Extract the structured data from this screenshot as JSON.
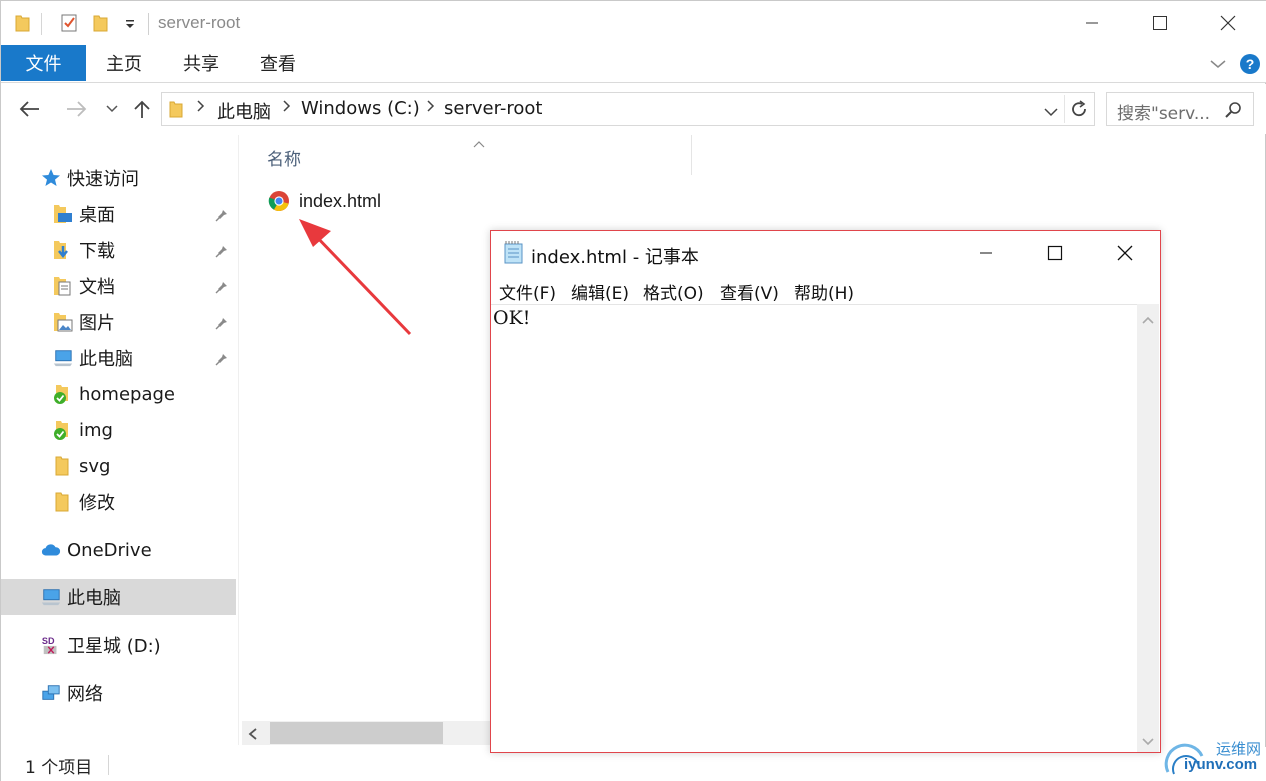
{
  "window": {
    "title": "server-root",
    "quick_access_toolbar": [
      "folder-icon",
      "properties-check-icon",
      "new-folder-icon",
      "customize-dropdown-icon"
    ]
  },
  "ribbon": {
    "tabs": [
      {
        "label": "文件"
      },
      {
        "label": "主页"
      },
      {
        "label": "共享"
      },
      {
        "label": "查看"
      }
    ]
  },
  "address": {
    "breadcrumbs": [
      "此电脑",
      "Windows (C:)",
      "server-root"
    ],
    "search_placeholder": "搜索\"serv..."
  },
  "navigation": {
    "quick_access_label": "快速访问",
    "quick_items": [
      {
        "label": "桌面",
        "icon": "desktop-folder-icon",
        "pinned": true
      },
      {
        "label": "下载",
        "icon": "downloads-folder-icon",
        "pinned": true
      },
      {
        "label": "文档",
        "icon": "documents-folder-icon",
        "pinned": true
      },
      {
        "label": "图片",
        "icon": "pictures-folder-icon",
        "pinned": true
      },
      {
        "label": "此电脑",
        "icon": "computer-icon",
        "pinned": true
      },
      {
        "label": "homepage",
        "icon": "synced-folder-icon",
        "pinned": false
      },
      {
        "label": "img",
        "icon": "synced-folder-icon",
        "pinned": false
      },
      {
        "label": "svg",
        "icon": "folder-icon",
        "pinned": false
      },
      {
        "label": "修改",
        "icon": "folder-icon",
        "pinned": false
      }
    ],
    "onedrive_label": "OneDrive",
    "thispc_label": "此电脑",
    "drive_label": "卫星城 (D:)",
    "network_label": "网络"
  },
  "content": {
    "column_header": "名称",
    "files": [
      {
        "name": "index.html",
        "icon": "chrome-icon"
      }
    ]
  },
  "status": {
    "item_count": "1 个项目"
  },
  "notepad": {
    "title": "index.html - 记事本",
    "menu": [
      "文件(F)",
      "编辑(E)",
      "格式(O)",
      "查看(V)",
      "帮助(H)"
    ],
    "content": "OK!"
  },
  "watermark": {
    "text_top": "运维网",
    "text_bottom": "iyunv.com"
  },
  "colors": {
    "file_tab_bg": "#1979ca",
    "help_icon": "#1979ca",
    "selection_bg": "#d9d9d9",
    "notepad_border": "#e0454b",
    "annotation_arrow": "#e8393d"
  }
}
